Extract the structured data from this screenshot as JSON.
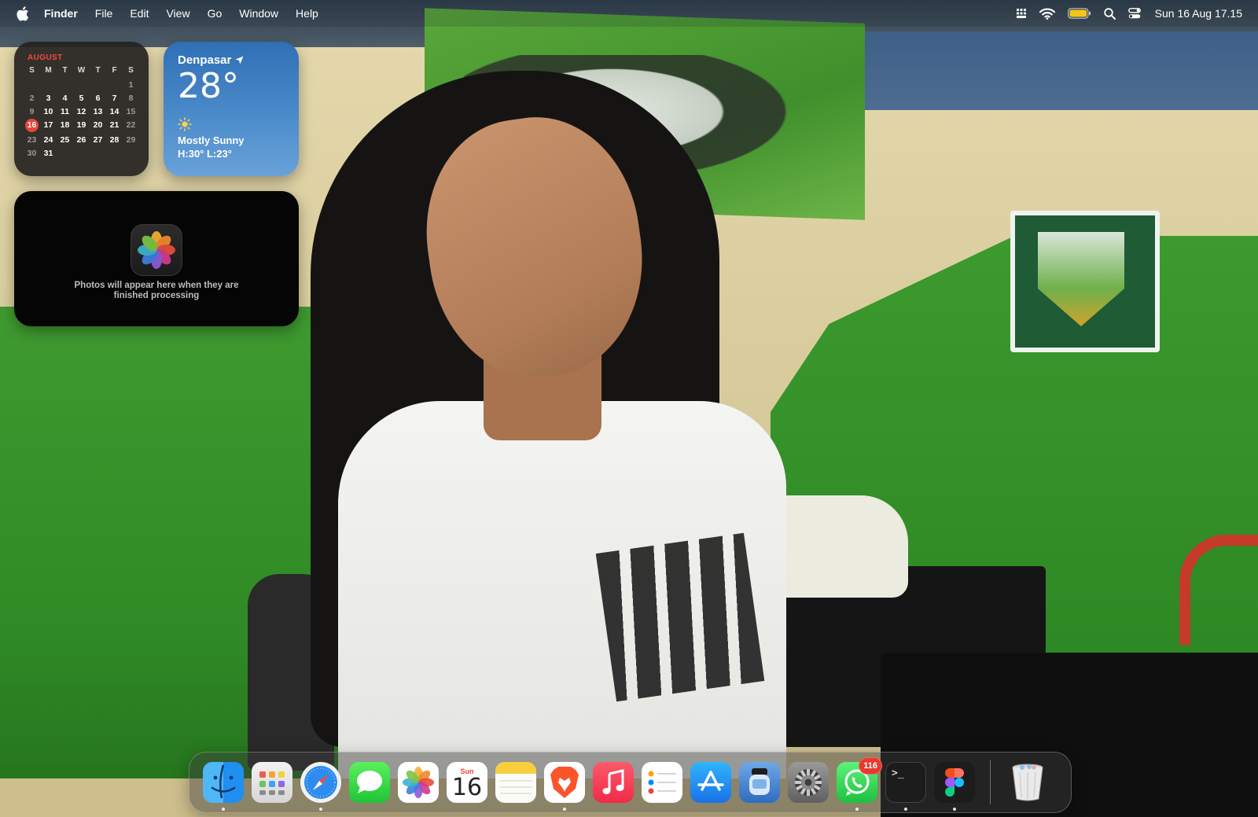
{
  "menubar": {
    "app_name": "Finder",
    "menus": [
      "File",
      "Edit",
      "View",
      "Go",
      "Window",
      "Help"
    ],
    "clock": "Sun 16 Aug  17.15",
    "status_icons": [
      "keyboard-icon",
      "wifi-icon",
      "battery-icon",
      "search-icon",
      "control-center-icon"
    ],
    "battery_color": "#f5c518"
  },
  "calendar_widget": {
    "month": "AUGUST",
    "weekdays": [
      "S",
      "M",
      "T",
      "W",
      "T",
      "F",
      "S"
    ],
    "weeks": [
      [
        "",
        "",
        "",
        "",
        "",
        "",
        "1"
      ],
      [
        "2",
        "3",
        "4",
        "5",
        "6",
        "7",
        "8"
      ],
      [
        "9",
        "10",
        "11",
        "12",
        "13",
        "14",
        "15"
      ],
      [
        "16",
        "17",
        "18",
        "19",
        "20",
        "21",
        "22"
      ],
      [
        "23",
        "24",
        "25",
        "26",
        "27",
        "28",
        "29"
      ],
      [
        "30",
        "31",
        "",
        "",
        "",
        "",
        ""
      ]
    ],
    "today": "16",
    "accent_color": "#e8453c"
  },
  "weather_widget": {
    "city": "Denpasar",
    "temperature": "28°",
    "condition": "Mostly Sunny",
    "range": "H:30° L:23°"
  },
  "photos_widget": {
    "message": "Photos will appear here when they are finished processing"
  },
  "dock": {
    "apps": [
      {
        "name": "Finder",
        "icon": "finder-icon",
        "running": true
      },
      {
        "name": "Launchpad",
        "icon": "launchpad-icon",
        "running": false
      },
      {
        "name": "Safari",
        "icon": "safari-icon",
        "running": true
      },
      {
        "name": "Messages",
        "icon": "messages-icon",
        "running": false
      },
      {
        "name": "Photos",
        "icon": "photos-icon",
        "running": false
      },
      {
        "name": "Calendar",
        "icon": "calendar-icon",
        "running": false,
        "day": "Sun",
        "date": "16"
      },
      {
        "name": "Notes",
        "icon": "notes-icon",
        "running": false
      },
      {
        "name": "Brave",
        "icon": "brave-icon",
        "running": true
      },
      {
        "name": "Music",
        "icon": "music-icon",
        "running": false
      },
      {
        "name": "Reminders",
        "icon": "reminders-icon",
        "running": false
      },
      {
        "name": "App Store",
        "icon": "app-store-icon",
        "running": false
      },
      {
        "name": "Preview",
        "icon": "preview-icon",
        "running": false
      },
      {
        "name": "System Settings",
        "icon": "system-settings-icon",
        "running": false
      },
      {
        "name": "WhatsApp",
        "icon": "whatsapp-icon",
        "running": true,
        "badge": "116"
      },
      {
        "name": "Terminal",
        "icon": "terminal-icon",
        "running": true,
        "glyph": ">_"
      },
      {
        "name": "Figma",
        "icon": "figma-icon",
        "running": true
      }
    ],
    "trash": {
      "name": "Trash",
      "icon": "trash-icon"
    }
  }
}
